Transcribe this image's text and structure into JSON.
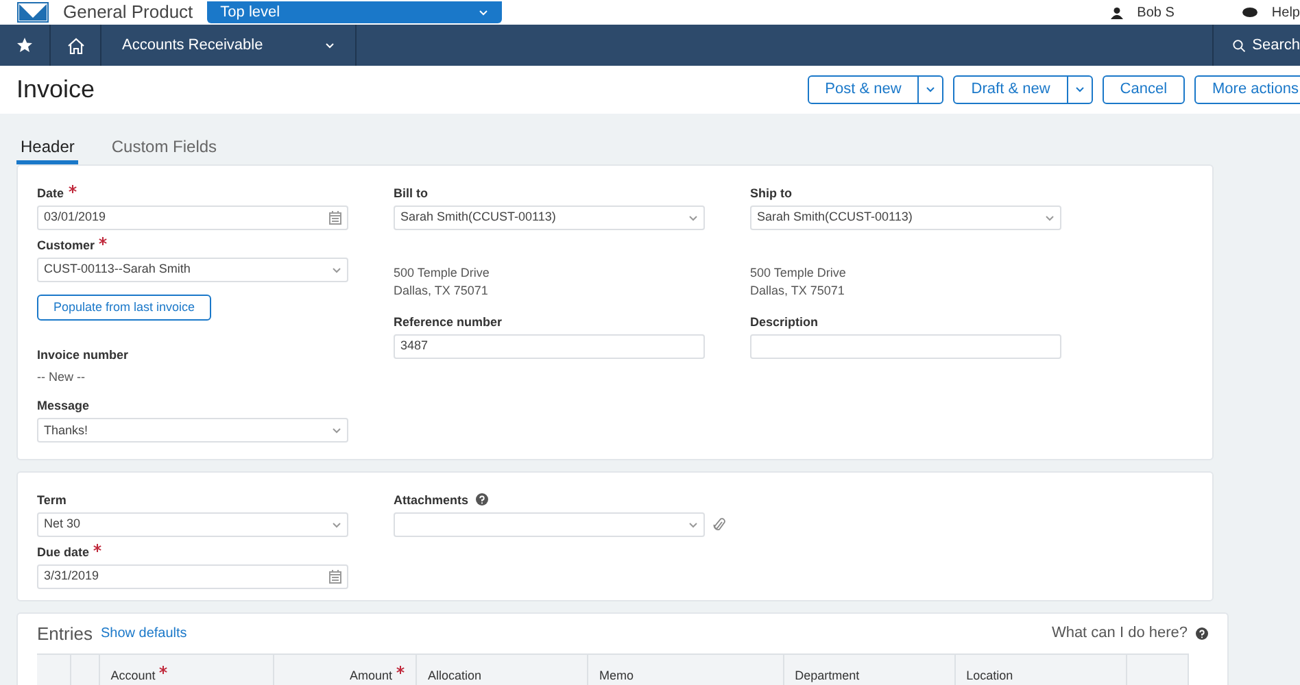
{
  "top_bar": {
    "company": "General Product",
    "entity_select": "Top level",
    "user": "Bob S",
    "help": "Help"
  },
  "nav": {
    "module": "Accounts Receivable",
    "search": "Search"
  },
  "page": {
    "title": "Invoice",
    "actions": [
      {
        "label": "Post & new",
        "split": true
      },
      {
        "label": "Draft & new",
        "split": true
      },
      {
        "label": "Cancel",
        "split": false
      },
      {
        "label": "More actions",
        "split": false
      }
    ]
  },
  "tabs": [
    {
      "label": "Header",
      "selected": true
    },
    {
      "label": "Custom Fields",
      "selected": false
    }
  ],
  "header_card": {
    "columns": [
      [
        {
          "kind": "date",
          "label": "Date",
          "required": true,
          "value": "03/01/2019"
        },
        {
          "kind": "select",
          "label": "Customer",
          "required": true,
          "value": "CUST-00113--Sarah Smith"
        },
        {
          "kind": "button",
          "label": "Populate from last invoice"
        },
        {
          "kind": "static",
          "label": "Invoice number",
          "value": "-- New --"
        },
        {
          "kind": "select",
          "label": "Message",
          "required": false,
          "value": "Thanks!"
        }
      ],
      [
        {
          "kind": "select",
          "label": "Bill to",
          "required": false,
          "value": "Sarah Smith(CCUST-00113)"
        },
        {
          "kind": "address",
          "lines": [
            "500 Temple Drive",
            "Dallas, TX 75071"
          ]
        },
        {
          "kind": "text",
          "label": "Reference number",
          "required": false,
          "value": "3487"
        }
      ],
      [
        {
          "kind": "select",
          "label": "Ship to",
          "required": false,
          "value": "Sarah Smith(CCUST-00113)"
        },
        {
          "kind": "address",
          "lines": [
            "500 Temple Drive",
            "Dallas, TX 75071"
          ]
        },
        {
          "kind": "text",
          "label": "Description",
          "required": false
        }
      ]
    ]
  },
  "terms_card": {
    "columns": [
      [
        {
          "kind": "select",
          "label": "Term",
          "required": false,
          "value": "Net 30"
        },
        {
          "kind": "date",
          "label": "Due date",
          "required": true,
          "value": "3/31/2019"
        }
      ],
      [
        {
          "kind": "attach",
          "label": "Attachments",
          "required": false
        }
      ]
    ]
  },
  "entries": {
    "title": "Entries",
    "link": "Show defaults",
    "help": "What can I do here?",
    "columns": [
      {
        "kind": "blank"
      },
      {
        "kind": "blank"
      },
      {
        "kind": "text",
        "label": "Account",
        "required": true
      },
      {
        "kind": "amount",
        "label": "Amount",
        "required": true
      },
      {
        "kind": "text",
        "label": "Allocation",
        "required": false
      },
      {
        "kind": "text",
        "label": "Memo",
        "required": false
      },
      {
        "kind": "text",
        "label": "Department",
        "required": false
      },
      {
        "kind": "text",
        "label": "Location",
        "required": false
      },
      {
        "kind": "blank"
      }
    ]
  }
}
